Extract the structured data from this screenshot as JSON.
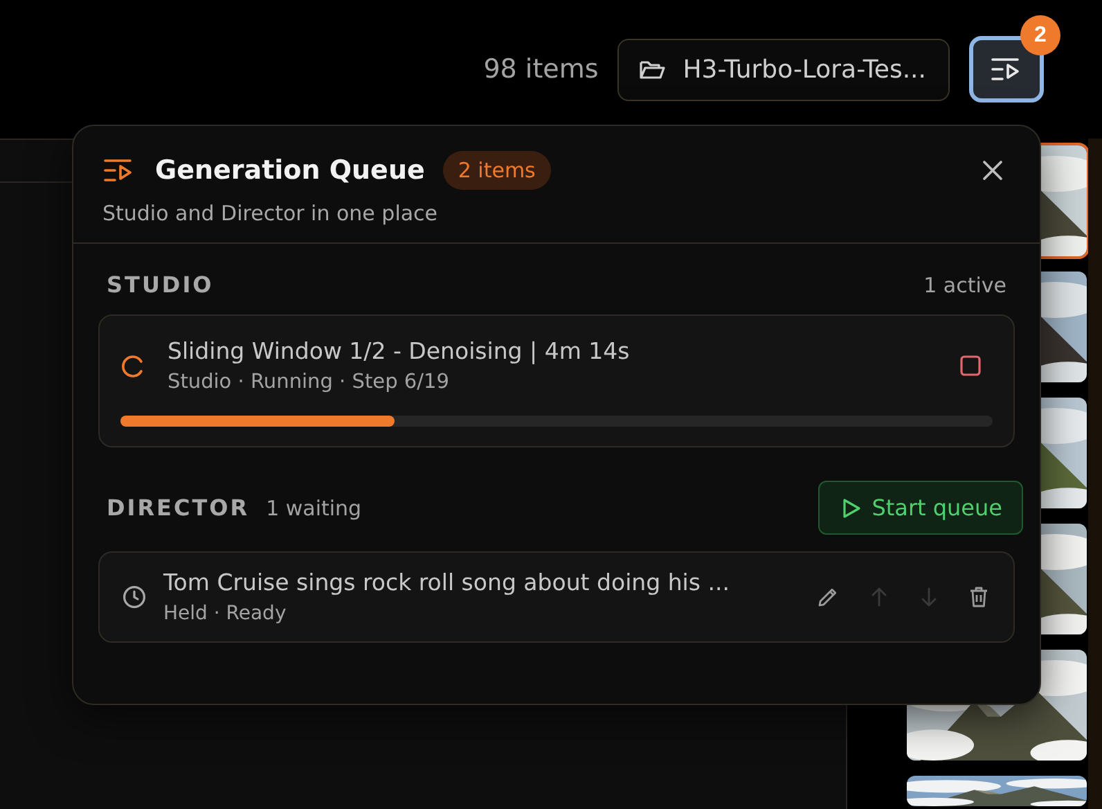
{
  "header": {
    "items_count": "98 items",
    "folder": "H3-Turbo-Lora-Tes...",
    "queue_badge": "2"
  },
  "thumbnails": [
    {
      "kind": "picture",
      "selected": true
    },
    {
      "kind": "picture",
      "selected": false
    },
    {
      "kind": "picture",
      "selected": false
    },
    {
      "kind": "picture",
      "selected": false
    },
    {
      "kind": "picture",
      "selected": false
    },
    {
      "kind": "picture",
      "selected": false
    }
  ],
  "queue": {
    "title": "Generation Queue",
    "count": "2 items",
    "subtitle": "Studio and Director in one place",
    "studio": {
      "label": "STUDIO",
      "status": "1 active",
      "jobs": [
        {
          "title": "Sliding Window 1/2 - Denoising | 4m 14s",
          "meta": "Studio · Running · Step 6/19",
          "level": 0.315
        }
      ]
    },
    "director": {
      "label": "DIRECTOR",
      "status": "1 waiting",
      "start_button": "Start queue",
      "items": [
        {
          "title": "Tom Cruise sings rock roll song about doing his ...",
          "meta": "Held · Ready",
          "actions": [
            {
              "kind": "edit",
              "disabled": false
            },
            {
              "kind": "up",
              "disabled": true
            },
            {
              "kind": "down",
              "disabled": true
            },
            {
              "kind": "delete",
              "disabled": false
            }
          ]
        }
      ]
    }
  }
}
